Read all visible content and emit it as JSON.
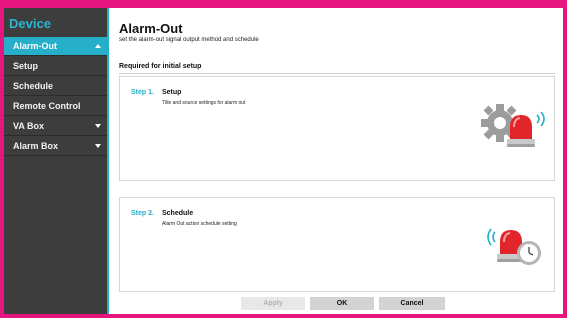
{
  "sidebar": {
    "title": "Device",
    "items": [
      {
        "label": "Alarm-Out",
        "active": true,
        "chevron": "chevron-up"
      },
      {
        "label": "Setup"
      },
      {
        "label": "Schedule"
      },
      {
        "label": "Remote Control"
      },
      {
        "label": "VA Box",
        "chevron": "chevron-down"
      },
      {
        "label": "Alarm Box",
        "chevron": "chevron-down"
      }
    ]
  },
  "main": {
    "title": "Alarm-Out",
    "subtitle": "set the alarm-out signal output method and schedule",
    "section_label": "Required for initial setup",
    "steps": [
      {
        "number": "Step 1.",
        "title": "Setup",
        "description": "Title and source settings for alarm out",
        "icon": "gear-alarm-light-icon"
      },
      {
        "number": "Step 2.",
        "title": "Schedule",
        "description": "Alarm Out action schedule setting",
        "icon": "alarm-light-clock-icon"
      }
    ]
  },
  "buttons": {
    "apply": "Apply",
    "ok": "OK",
    "cancel": "Cancel"
  },
  "colors": {
    "accent": "#27aec8",
    "sidebar_bg": "#3d3d3d",
    "frame_border": "#e5177f",
    "alarm_red": "#e0262b"
  }
}
